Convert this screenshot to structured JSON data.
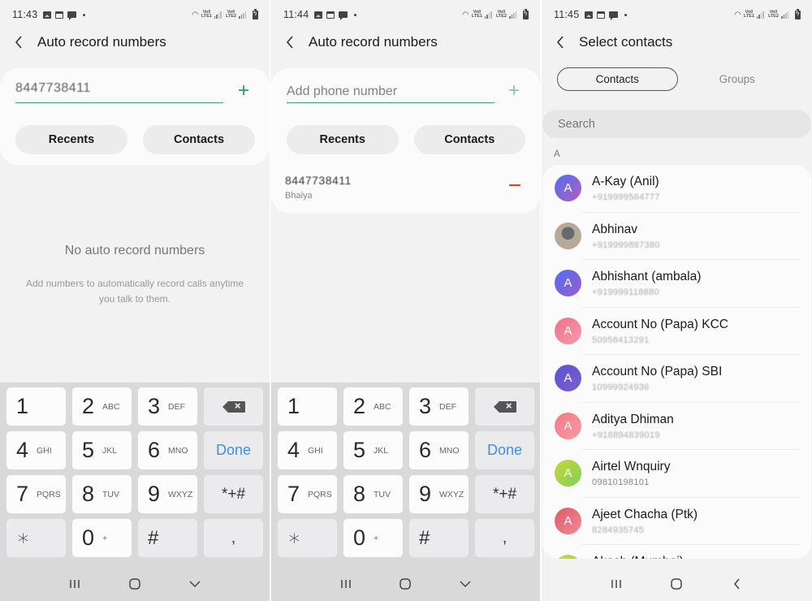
{
  "screens": [
    {
      "status": {
        "time": "11:43"
      },
      "header": {
        "title": "Auto record numbers",
        "back_icon": "chevron-left-icon"
      },
      "input": {
        "value": "8447738411",
        "placeholder": "Add phone number",
        "add_icon": "plus-icon"
      },
      "buttons": {
        "recents": "Recents",
        "contacts": "Contacts"
      },
      "empty_state": {
        "title": "No auto record numbers",
        "subtitle": "Add numbers to automatically record calls anytime you talk to them."
      }
    },
    {
      "status": {
        "time": "11:44"
      },
      "header": {
        "title": "Auto record numbers",
        "back_icon": "chevron-left-icon"
      },
      "input": {
        "value": "",
        "placeholder": "Add phone number",
        "add_icon": "plus-icon"
      },
      "buttons": {
        "recents": "Recents",
        "contacts": "Contacts"
      },
      "entries": [
        {
          "number": "8447738411",
          "label": "Bhaiya",
          "remove_icon": "minus-icon"
        }
      ]
    },
    {
      "status": {
        "time": "11:45"
      },
      "header": {
        "title": "Select contacts",
        "back_icon": "chevron-left-icon"
      },
      "tabs": [
        {
          "label": "Contacts",
          "active": true
        },
        {
          "label": "Groups",
          "active": false
        }
      ],
      "search": {
        "placeholder": "Search",
        "value": ""
      },
      "index_letter": "A",
      "contacts": [
        {
          "name": "A-Kay (Anil)",
          "phone": "+919999564777",
          "initial": "A",
          "colors": [
            "#4f6ef7",
            "#b55fb8"
          ]
        },
        {
          "name": "Abhinav",
          "phone": "+919999887380",
          "initial": "",
          "photo": true
        },
        {
          "name": "Abhishant (ambala)",
          "phone": "+919999118880",
          "initial": "A",
          "colors": [
            "#4f6ef7",
            "#9a5fc8"
          ]
        },
        {
          "name": "Account No (Papa) KCC",
          "phone": "50958413291",
          "initial": "A",
          "colors": [
            "#f07088",
            "#f79aab"
          ]
        },
        {
          "name": "Account No (Papa) SBI",
          "phone": "10999924936",
          "initial": "A",
          "colors": [
            "#5b52d6",
            "#7b5fcc"
          ]
        },
        {
          "name": "Aditya Dhiman",
          "phone": "+918894839019",
          "initial": "A",
          "colors": [
            "#f07a87",
            "#f79aa4"
          ]
        },
        {
          "name": "Airtel Wnquiry",
          "phone": "09810198101",
          "initial": "A",
          "colors": [
            "#c5d93a",
            "#7fcf5a"
          ]
        },
        {
          "name": "Ajeet Chacha (Ptk)",
          "phone": "8284935745",
          "initial": "A",
          "colors": [
            "#e05a6a",
            "#ef8a94"
          ]
        },
        {
          "name": "Akash (Mumbai)",
          "phone": "",
          "initial": "A",
          "colors": [
            "#c5d93a",
            "#a5d04a"
          ]
        }
      ]
    }
  ],
  "keypad": {
    "rows": [
      [
        {
          "d": "1",
          "l": ""
        },
        {
          "d": "2",
          "l": "ABC"
        },
        {
          "d": "3",
          "l": "DEF"
        },
        {
          "fn": "backspace"
        }
      ],
      [
        {
          "d": "4",
          "l": "GHI"
        },
        {
          "d": "5",
          "l": "JKL"
        },
        {
          "d": "6",
          "l": "MNO"
        },
        {
          "fn": "done",
          "label": "Done"
        }
      ],
      [
        {
          "d": "7",
          "l": "PQRS"
        },
        {
          "d": "8",
          "l": "TUV"
        },
        {
          "d": "9",
          "l": "WXYZ"
        },
        {
          "fn": "sym",
          "label": "*+#"
        }
      ],
      [
        {
          "fn": "star",
          "label": "∗"
        },
        {
          "d": "0",
          "l": "+"
        },
        {
          "fn": "hash",
          "label": "#"
        },
        {
          "fn": "comma",
          "label": ","
        }
      ]
    ]
  },
  "navbar": {
    "recents_icon": "recent-apps-icon",
    "home_icon": "home-icon",
    "hide_keyboard_icon": "chevron-down-icon",
    "back_icon": "back-icon"
  },
  "colors": {
    "accent_green": "#1fa055",
    "remove_red": "#e0441f",
    "done_blue": "#3d8fe6"
  }
}
